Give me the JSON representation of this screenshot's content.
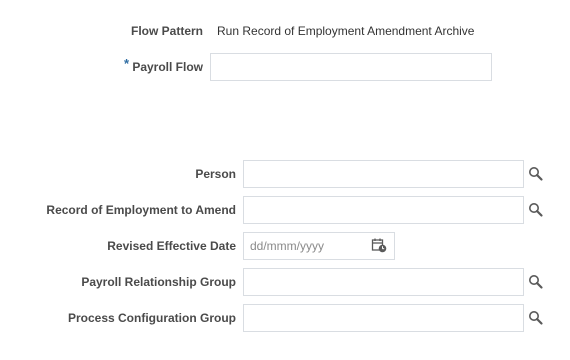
{
  "header": {
    "flow_pattern_label": "Flow Pattern",
    "flow_pattern_value": "Run Record of Employment Amendment Archive"
  },
  "payroll_flow": {
    "required_marker": "*",
    "label": "Payroll Flow",
    "value": ""
  },
  "parameters": {
    "person_label": "Person",
    "record_label": "Record of Employment to Amend",
    "revised_date_label": "Revised Effective Date",
    "revised_date_placeholder": "dd/mmm/yyyy",
    "relationship_group_label": "Payroll Relationship Group",
    "process_config_label": "Process Configuration Group"
  },
  "colors": {
    "label_text": "#4a4a4a",
    "input_border": "#d9dde2",
    "required_marker": "#2f6da3",
    "icon": "#5a5a5a"
  }
}
